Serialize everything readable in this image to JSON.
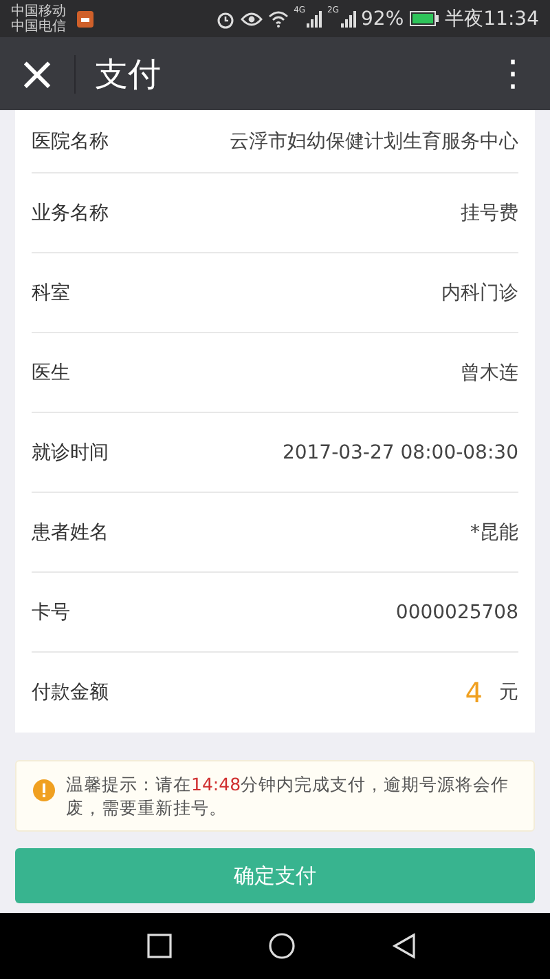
{
  "status_bar": {
    "carriers": [
      "中国移动",
      "中国电信"
    ],
    "battery": "92%",
    "time": "半夜11:34",
    "signal_labels": [
      "4G",
      "2G"
    ]
  },
  "header": {
    "close": "×",
    "title": "支付",
    "menu": "⋮"
  },
  "rows": [
    {
      "label": "医院名称",
      "value": "云浮市妇幼保健计划生育服务中心",
      "kind": "text"
    },
    {
      "label": "业务名称",
      "value": "挂号费",
      "kind": "text"
    },
    {
      "label": "科室",
      "value": "内科门诊",
      "kind": "text"
    },
    {
      "label": "医生",
      "value": "曾木连",
      "kind": "text"
    },
    {
      "label": "就诊时间",
      "value": "2017-03-27 08:00-08:30",
      "kind": "text"
    },
    {
      "label": "患者姓名",
      "value": "*昆能",
      "kind": "text"
    },
    {
      "label": "卡号",
      "value": "0000025708",
      "kind": "text"
    },
    {
      "label": "付款金额",
      "value": "4",
      "unit": "元",
      "kind": "amount"
    }
  ],
  "notice": {
    "before": "温馨提示：请在",
    "time": "14:48",
    "after": "分钟内完成支付，逾期号源将会作废，需要重新挂号。"
  },
  "confirm_button": "确定支付"
}
